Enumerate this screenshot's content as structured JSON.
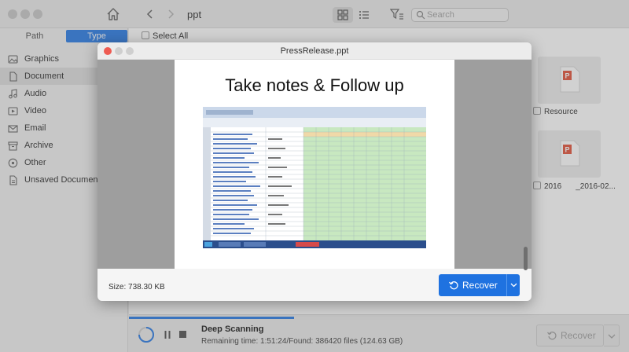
{
  "toolbar": {
    "folder_title": "ppt",
    "search_placeholder": "Search"
  },
  "sidebar": {
    "tabs": [
      "Path",
      "Type"
    ],
    "selected_tab": "Type",
    "items": [
      {
        "label": "Graphics",
        "icon": "graphics-icon"
      },
      {
        "label": "Document",
        "icon": "document-icon",
        "selected": true
      },
      {
        "label": "Audio",
        "icon": "audio-icon"
      },
      {
        "label": "Video",
        "icon": "video-icon"
      },
      {
        "label": "Email",
        "icon": "email-icon"
      },
      {
        "label": "Archive",
        "icon": "archive-icon"
      },
      {
        "label": "Other",
        "icon": "other-icon"
      },
      {
        "label": "Unsaved Documents",
        "icon": "unsaved-documents-icon"
      }
    ]
  },
  "main": {
    "select_all": "Select All",
    "files": [
      {
        "name": "Resource",
        "icon": "ppt-file-icon"
      },
      {
        "name": "2016",
        "name_suffix": "_2016-02...",
        "icon": "ppt-file-icon"
      }
    ]
  },
  "preview": {
    "title": "PressRelease.ppt",
    "slide_title": "Take notes & Follow up",
    "size_label": "Size: 738.30 KB",
    "recover_label": "Recover"
  },
  "status": {
    "title": "Deep Scanning",
    "info": "Remaining time: 1:51:24/Found: 386420 files (124.63 GB)",
    "recover_label": "Recover",
    "progress": 0.33
  },
  "colors": {
    "accent": "#2f7ee6",
    "button": "#1f72e0",
    "close": "#ee5b52"
  }
}
